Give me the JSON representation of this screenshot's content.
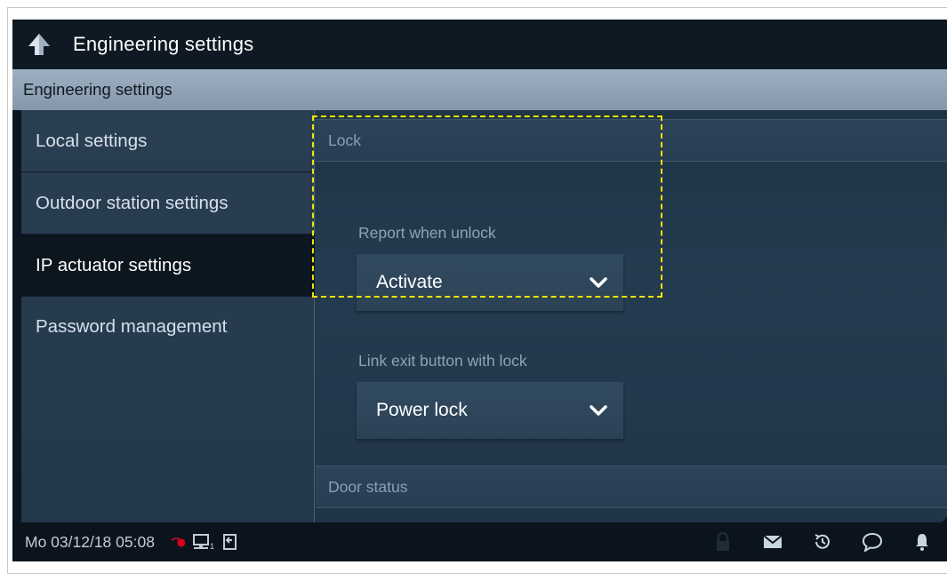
{
  "titlebar": {
    "title": "Engineering settings",
    "back_icon": "back-arrow-icon"
  },
  "section_header": {
    "title": "Engineering settings"
  },
  "sidebar": {
    "items": [
      {
        "label": "Local settings",
        "active": false
      },
      {
        "label": "Outdoor station settings",
        "active": false
      },
      {
        "label": "IP actuator settings",
        "active": true
      },
      {
        "label": "Password management",
        "active": false
      }
    ]
  },
  "content": {
    "lock_group": {
      "title": "Lock"
    },
    "report_when_unlock": {
      "label": "Report when unlock",
      "value": "Activate"
    },
    "link_exit_button": {
      "label": "Link exit button with lock",
      "value": "Power lock"
    },
    "door_status_group": {
      "title": "Door status"
    }
  },
  "statusbar": {
    "datetime": "Mo 03/12/18  05:08",
    "left_icons": [
      "alarm-camera-icon",
      "network-icon",
      "door-exit-icon"
    ],
    "network_suffix": "1",
    "right_icons": [
      "lock-icon",
      "mail-icon",
      "history-icon",
      "message-icon",
      "bell-icon"
    ]
  },
  "colors": {
    "highlight": "#f4e500",
    "header": "#8fa2b5",
    "active_item": "#0c161f",
    "alert_red": "#d8001a"
  }
}
